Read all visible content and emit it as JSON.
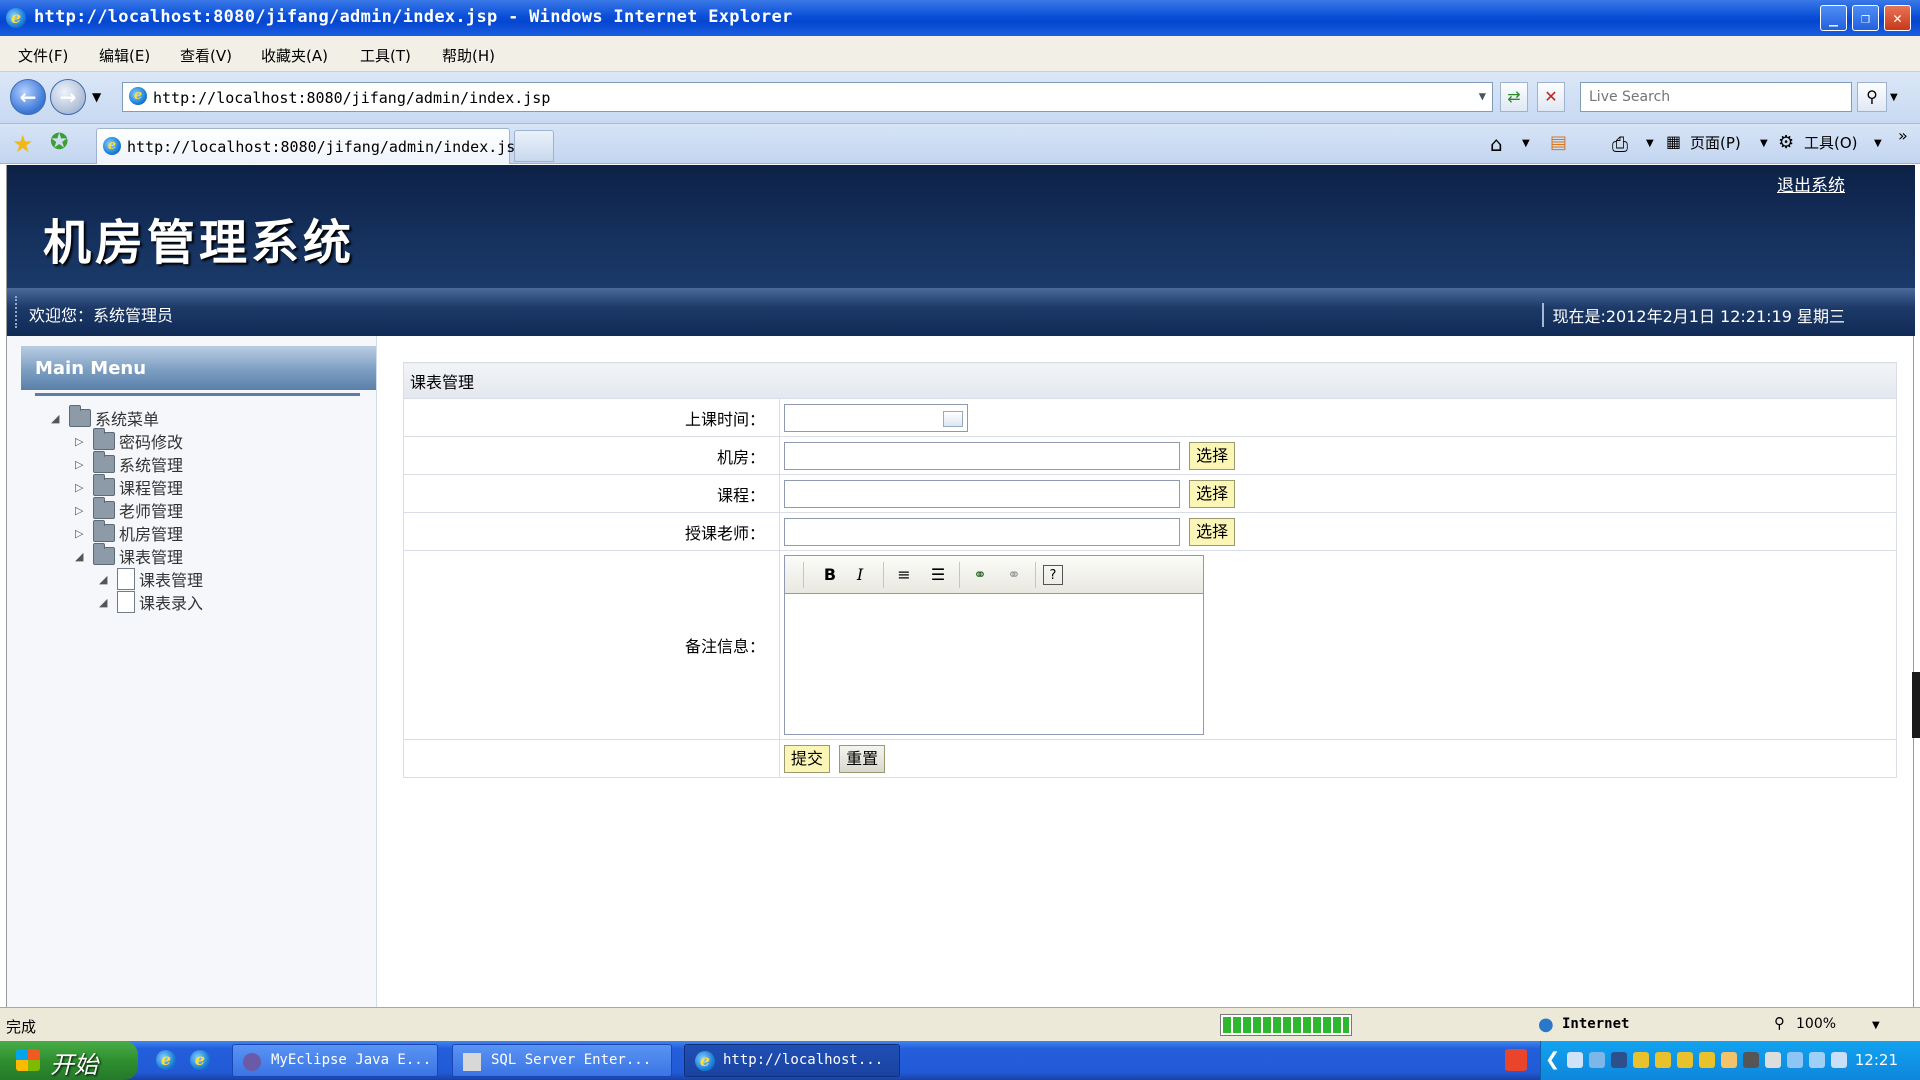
{
  "window": {
    "title": "http://localhost:8080/jifang/admin/index.jsp - Windows Internet Explorer",
    "buttons": {
      "minimize": "_",
      "maximize": "❐",
      "close": "✕"
    }
  },
  "menu": [
    "文件(F)",
    "编辑(E)",
    "查看(V)",
    "收藏夹(A)",
    "工具(T)",
    "帮助(H)"
  ],
  "address": {
    "url": "http://localhost:8080/jifang/admin/index.jsp",
    "search_placeholder": "Live Search"
  },
  "tab": {
    "label": "http://localhost:8080/jifang/admin/index.jsp"
  },
  "commandbar": {
    "page": "页面(P)",
    "tools": "工具(O)"
  },
  "site": {
    "title": "机房管理系统",
    "logout": "退出系统",
    "welcome": "欢迎您：系统管理员",
    "datetime": "现在是:2012年2月1日 12:21:19 星期三"
  },
  "sidebar": {
    "heading": "Main Menu",
    "root": "系统菜单",
    "items": [
      "密码修改",
      "系统管理",
      "课程管理",
      "老师管理",
      "机房管理",
      "课表管理"
    ],
    "subitems": [
      "课表管理",
      "课表录入"
    ]
  },
  "form": {
    "title": "课表管理",
    "fields": {
      "time": {
        "label": "上课时间：",
        "value": ""
      },
      "room": {
        "label": "机房：",
        "value": ""
      },
      "course": {
        "label": "课程：",
        "value": ""
      },
      "teacher": {
        "label": "授课老师：",
        "value": ""
      },
      "remark": {
        "label": "备注信息："
      }
    },
    "pick_label": "选择",
    "submit": "提交",
    "reset": "重置",
    "editor_tools": {
      "bold": "B",
      "italic": "I",
      "help": "?"
    }
  },
  "status": {
    "text": "完成",
    "zone": "Internet",
    "zoom": "100%",
    "progress": 1.0
  },
  "taskbar": {
    "start": "开始",
    "tasks": [
      "MyEclipse Java E...",
      "SQL Server Enter...",
      "http://localhost..."
    ],
    "clock": "12:21"
  }
}
